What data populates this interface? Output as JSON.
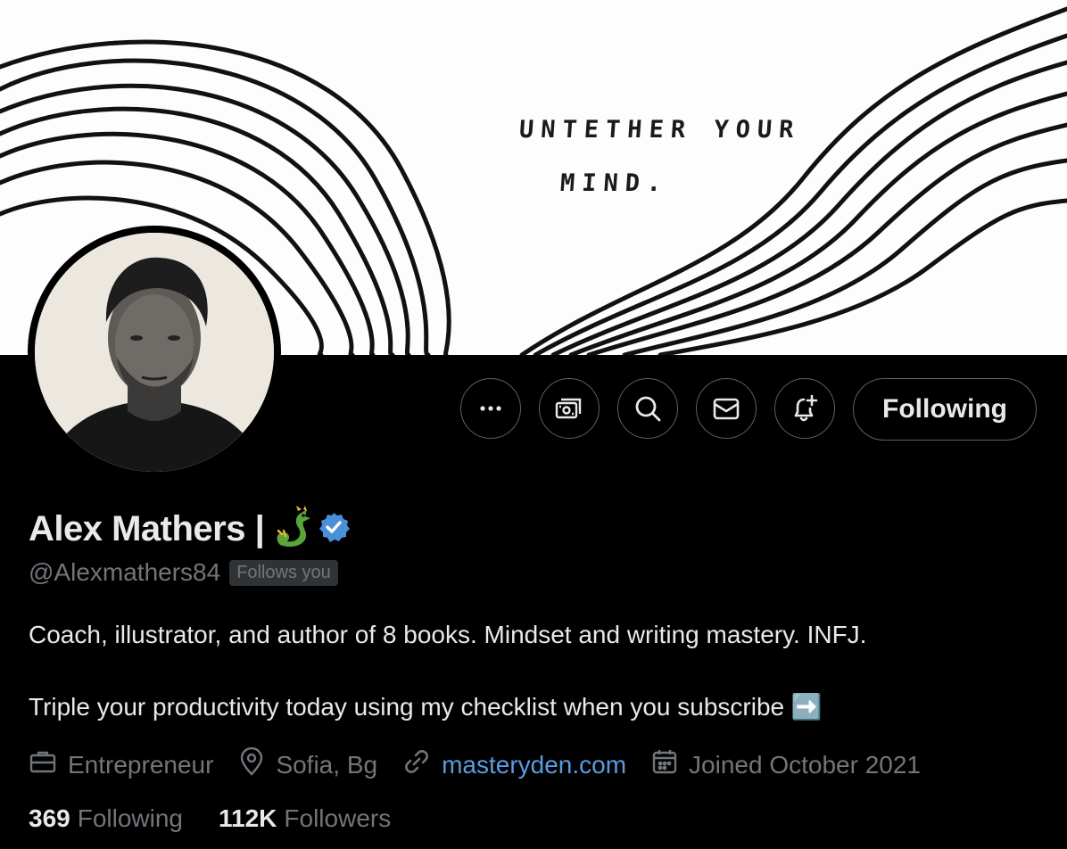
{
  "banner": {
    "line1": "UNTETHER YOUR",
    "line2": "MIND."
  },
  "actions": {
    "more_icon": "more-horizontal-icon",
    "subscribe_icon": "subscriptions-icon",
    "search_icon": "search-icon",
    "message_icon": "envelope-icon",
    "notify_icon": "bell-plus-icon",
    "following_label": "Following"
  },
  "profile": {
    "name": "Alex Mathers |",
    "name_emoji": "dragon-emoji",
    "verified_icon": "verified-badge-icon",
    "verified_color": "#4a90d9",
    "handle": "@Alexmathers84",
    "follows_you": "Follows you",
    "bio_line1": "Coach, illustrator, and author of 8 books. Mindset and writing mastery. INFJ.",
    "bio_line2": "Triple your productivity today using my checklist when you subscribe ➡️"
  },
  "meta": {
    "category": "Entrepreneur",
    "location": "Sofia, Bg",
    "website": "masteryden.com",
    "joined": "Joined October 2021",
    "link_color": "#5b9be0"
  },
  "stats": {
    "following_count": "369",
    "following_label": "Following",
    "followers_count": "112K",
    "followers_label": "Followers"
  },
  "colors": {
    "background": "#000000",
    "text_primary": "#e7e9ea",
    "text_secondary": "#71767b",
    "border": "#536471"
  }
}
